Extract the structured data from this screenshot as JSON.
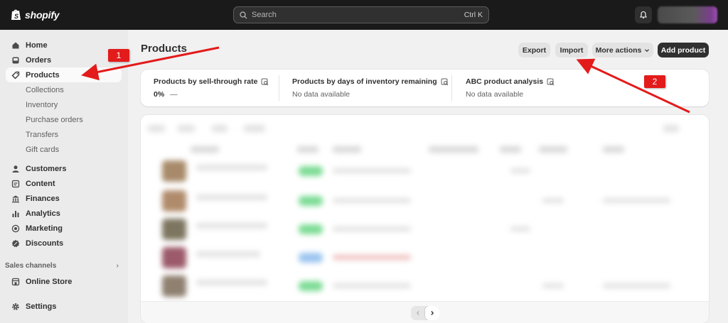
{
  "topbar": {
    "brand": "shopify",
    "search": {
      "placeholder": "Search",
      "shortcut": "Ctrl K"
    }
  },
  "sidebar": {
    "items": [
      {
        "label": "Home",
        "icon": "home-icon"
      },
      {
        "label": "Orders",
        "icon": "inbox-icon"
      },
      {
        "label": "Products",
        "icon": "tag-icon",
        "active": true
      },
      {
        "label": "Customers",
        "icon": "person-icon"
      },
      {
        "label": "Content",
        "icon": "content-icon"
      },
      {
        "label": "Finances",
        "icon": "bank-icon"
      },
      {
        "label": "Analytics",
        "icon": "bar-chart-icon"
      },
      {
        "label": "Marketing",
        "icon": "target-icon"
      },
      {
        "label": "Discounts",
        "icon": "discount-icon"
      }
    ],
    "product_subitems": [
      "Collections",
      "Inventory",
      "Purchase orders",
      "Transfers",
      "Gift cards"
    ],
    "sales_channels_label": "Sales channels",
    "online_store": "Online Store",
    "settings": "Settings"
  },
  "main": {
    "title": "Products",
    "buttons": {
      "export": "Export",
      "import": "Import",
      "more_actions": "More actions",
      "add_product": "Add product"
    },
    "metrics": [
      {
        "title": "Products by sell-through rate",
        "value": "0%",
        "value_suffix": "—"
      },
      {
        "title": "Products by days of inventory remaining",
        "value_text": "No data available"
      },
      {
        "title": "ABC product analysis",
        "value_text": "No data available"
      }
    ]
  },
  "annotations": {
    "marker1": "1",
    "marker2": "2",
    "arrow_color": "#e31b1b"
  },
  "colors": {
    "topbar": "#1a1a1a",
    "sidebar": "#ebebeb",
    "primary_button": "#303030"
  }
}
